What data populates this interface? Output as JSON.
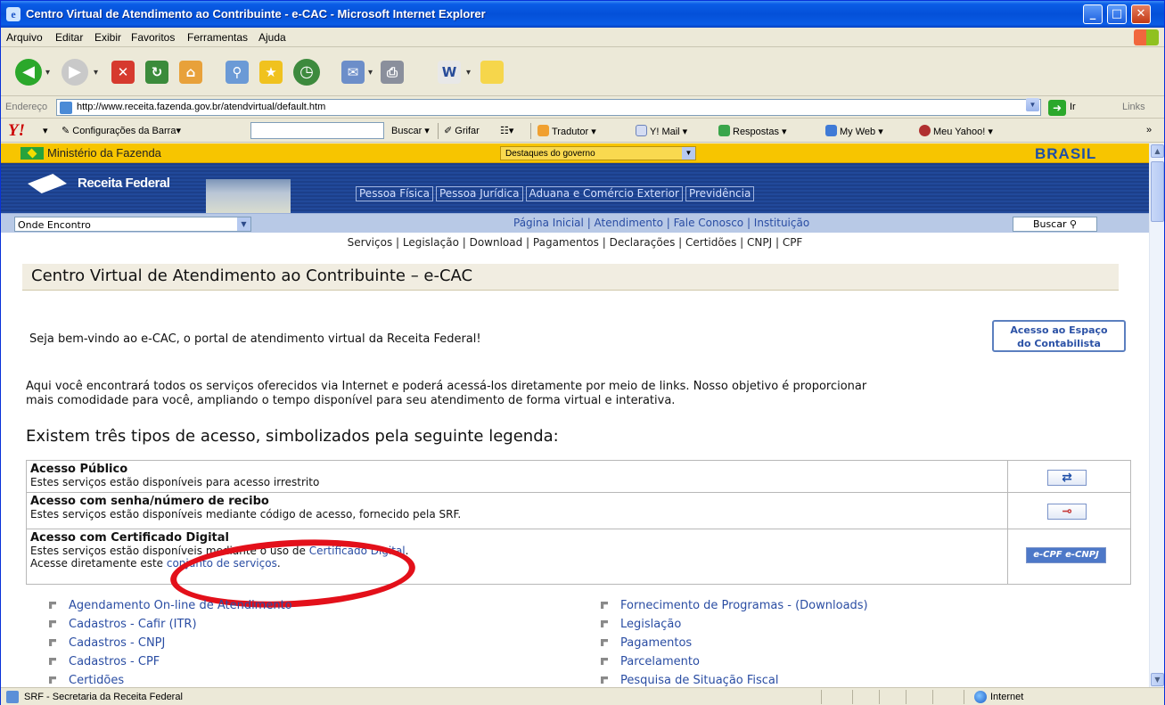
{
  "window": {
    "title": "Centro Virtual de Atendimento ao Contribuinte - e-CAC - Microsoft Internet Explorer",
    "minimize": "_",
    "maximize": "□",
    "close": "✕"
  },
  "menu": [
    "Arquivo",
    "Editar",
    "Exibir",
    "Favoritos",
    "Ferramentas",
    "Ajuda"
  ],
  "address": {
    "label": "Endereço",
    "url": "http://www.receita.fazenda.gov.br/atendvirtual/default.htm",
    "go_label": "Ir",
    "links_label": "Links"
  },
  "yahoo_toolbar": {
    "config": "Configurações da Barra",
    "search_btn": "Buscar",
    "grifar": "Grifar",
    "tradutor": "Tradutor",
    "mail": "Y! Mail",
    "respostas": "Respostas",
    "myweb": "My Web",
    "meuyahoo": "Meu Yahoo!"
  },
  "gov": {
    "ministerio": "Ministério da Fazenda",
    "destaques": "Destaques do governo",
    "brasil": "BRASIL"
  },
  "header": {
    "brand": "Receita Federal",
    "tabs": [
      "Pessoa Física",
      "Pessoa Jurídica",
      "Aduana e Comércio Exterior",
      "Previdência"
    ]
  },
  "nav": {
    "onde": "Onde Encontro",
    "links": "Página Inicial  |  Atendimento  |  Fale Conosco  |  Instituição",
    "buscar": "Buscar"
  },
  "services_row": "Serviços  |  Legislação  |  Download  |  Pagamentos  |  Declarações  |  Certidões  |  CNPJ  |  CPF",
  "content": {
    "heading": "Centro Virtual de Atendimento ao Contribuinte – e-CAC",
    "welcome": "Seja bem-vindo ao e-CAC, o portal de atendimento virtual da Receita Federal!",
    "contab_btn_1": "Acesso ao Espaço",
    "contab_btn_2": "do Contabilista",
    "para_1": "Aqui você encontrará todos os serviços oferecidos via Internet e poderá acessá-los diretamente por meio de links. Nosso objetivo é proporcionar",
    "para_2": "mais comodidade para você, ampliando o tempo disponível para seu atendimento de forma virtual e interativa.",
    "access_title": "Existem três tipos de acesso, simbolizados pela seguinte legenda:"
  },
  "legend": {
    "public_title": "Acesso Público",
    "public_desc": "Estes serviços estão disponíveis para acesso irrestrito",
    "senha_title": "Acesso com senha/número de recibo",
    "senha_desc": "Estes serviços estão disponíveis mediante código de acesso, fornecido pela SRF.",
    "cert_title": "Acesso com Certificado Digital",
    "cert_desc_pre": "Estes serviços estão disponíveis mediante o uso de ",
    "cert_desc_link": "Certificado Digital",
    "cert_desc_post": ".",
    "cert_direct_pre": "Acesse diretamente este ",
    "cert_direct_link": "conjunto de serviços",
    "cert_direct_post": ".",
    "cert_icon": "e-CPF e-CNPJ"
  },
  "services_left": [
    "Agendamento On-line de Atendimento",
    "Cadastros - Cafir (ITR)",
    "Cadastros - CNPJ",
    "Cadastros - CPF",
    "Certidões"
  ],
  "services_right": [
    "Fornecimento de Programas - (Downloads)",
    "Legislação",
    "Pagamentos",
    "Parcelamento",
    "Pesquisa de Situação Fiscal"
  ],
  "status": {
    "text": "SRF - Secretaria da Receita Federal",
    "zone": "Internet"
  }
}
